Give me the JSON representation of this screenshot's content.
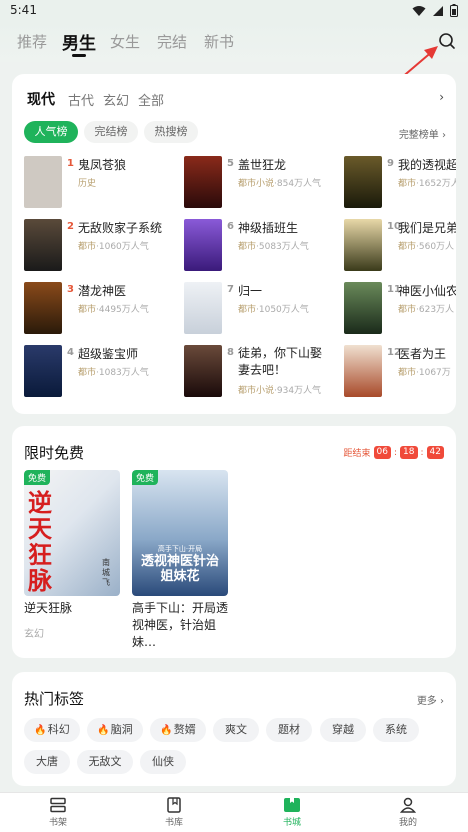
{
  "status_bar": {
    "time": "5:41"
  },
  "top_tabs": [
    {
      "label": "推荐"
    },
    {
      "label": "男生"
    },
    {
      "label": "女生"
    },
    {
      "label": "完结"
    },
    {
      "label": "新书"
    }
  ],
  "ranking": {
    "categories": [
      "现代",
      "古代",
      "玄幻",
      "全部"
    ],
    "more_arrow": "›",
    "pills": [
      "人气榜",
      "完结榜",
      "热搜榜"
    ],
    "full_rank": "完整榜单 ›",
    "items": [
      {
        "rank": "1",
        "title": "鬼凤苍狼",
        "genre": "历史",
        "meta": ""
      },
      {
        "rank": "2",
        "title": "无敌败家子系统",
        "genre": "都市",
        "meta": "·1060万人气"
      },
      {
        "rank": "3",
        "title": "潜龙神医",
        "genre": "都市",
        "meta": "·4495万人气"
      },
      {
        "rank": "4",
        "title": "超级鉴宝师",
        "genre": "都市",
        "meta": "·1083万人气"
      },
      {
        "rank": "5",
        "title": "盖世狂龙",
        "genre": "都市小说",
        "meta": "·854万人气"
      },
      {
        "rank": "6",
        "title": "神级插班生",
        "genre": "都市",
        "meta": "·5083万人气"
      },
      {
        "rank": "7",
        "title": "归一",
        "genre": "都市",
        "meta": "·1050万人气"
      },
      {
        "rank": "8",
        "title": "徒弟，你下山娶妻去吧！",
        "genre": "都市小说",
        "meta": "·934万人气"
      },
      {
        "rank": "9",
        "title": "我的透视超",
        "genre": "都市",
        "meta": "·1652万人"
      },
      {
        "rank": "10",
        "title": "我们是兄弟",
        "genre": "都市",
        "meta": "·560万人"
      },
      {
        "rank": "11",
        "title": "神医小仙农",
        "genre": "都市",
        "meta": "·623万人"
      },
      {
        "rank": "12",
        "title": "医者为王",
        "genre": "都市",
        "meta": "·1067万"
      }
    ],
    "cover_colors": [
      "#cfc9c2",
      "#3a2f2a",
      "#4a2a1a",
      "#1d2a4a",
      "#5a1a1a",
      "#6b3aa8",
      "#d8dde3",
      "#3a2a2a",
      "#2a3a1a",
      "#d8c9a8",
      "#4a5a3a",
      "#e8d8c8"
    ]
  },
  "free": {
    "title": "限时免费",
    "countdown_label": "距结束",
    "hh": "06",
    "mm": "18",
    "ss": "42",
    "books": [
      {
        "badge": "免费",
        "name": "逆天狂脉",
        "genre": "玄幻",
        "cover_text": "逆天狂脉",
        "cover_author": "南城飞"
      },
      {
        "badge": "免费",
        "name": "高手下山：开局透视神医，针治姐妹…",
        "genre": "",
        "cover_top": "高手下山·开局",
        "cover_text": "透视神医针治姐妹花"
      }
    ]
  },
  "tags": {
    "title": "热门标签",
    "more": "更多 ›",
    "items": [
      {
        "label": "科幻",
        "hot": true
      },
      {
        "label": "脑洞",
        "hot": true
      },
      {
        "label": "赘婿",
        "hot": true
      },
      {
        "label": "爽文",
        "hot": false
      },
      {
        "label": "题材",
        "hot": false
      },
      {
        "label": "穿越",
        "hot": false
      },
      {
        "label": "系统",
        "hot": false
      },
      {
        "label": "大唐",
        "hot": false
      },
      {
        "label": "无敌文",
        "hot": false
      },
      {
        "label": "仙侠",
        "hot": false
      }
    ],
    "fire_icon": "🔥"
  },
  "bottom_nav": [
    {
      "label": "书架"
    },
    {
      "label": "书库"
    },
    {
      "label": "书城"
    },
    {
      "label": "我的"
    }
  ],
  "colors": {
    "accent": "#1fb35b",
    "rank_top": "#e5583a",
    "annotation_arrow": "#e53935"
  }
}
